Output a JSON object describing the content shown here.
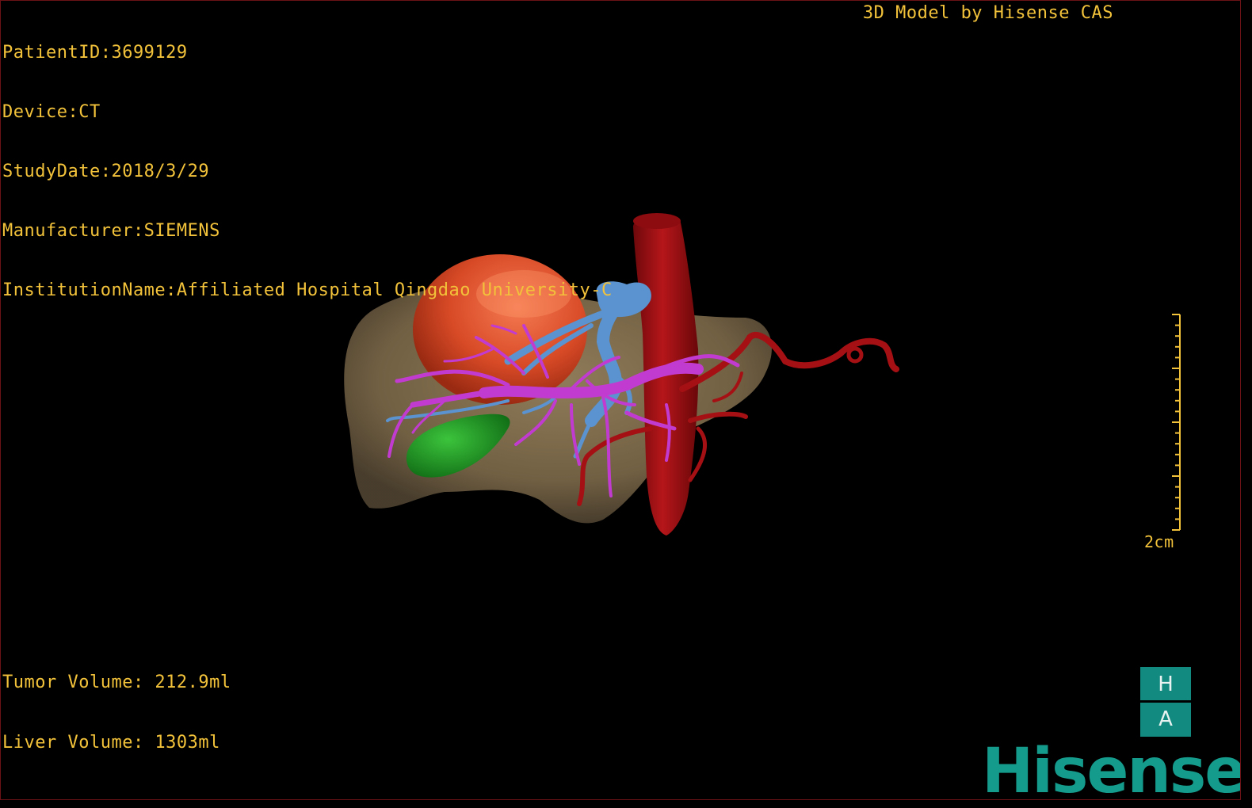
{
  "patient_info": {
    "patient_id": "PatientID:3699129",
    "device": "Device:CT",
    "study_date": "StudyDate:2018/3/29",
    "manufacturer": "Manufacturer:SIEMENS",
    "institution": "InstitutionName:Affiliated Hospital Qingdao University-C"
  },
  "credit": "3D Model by Hisense CAS",
  "volumes": {
    "tumor": "Tumor Volume: 212.9ml",
    "liver": "Liver Volume: 1303ml"
  },
  "scale": {
    "label": "2cm"
  },
  "orientation": {
    "top": "H",
    "bottom": "A"
  },
  "logo": "Hisense",
  "colors": {
    "overlay_text": "#f2c23a",
    "liver": "#7d6a4c",
    "tumor": "#e0552e",
    "hepatic_vein": "#5a93cf",
    "portal_vein": "#c23bd0",
    "artery": "#a51014",
    "gallbladder": "#1c9a22",
    "brand_teal": "#159b8c"
  }
}
